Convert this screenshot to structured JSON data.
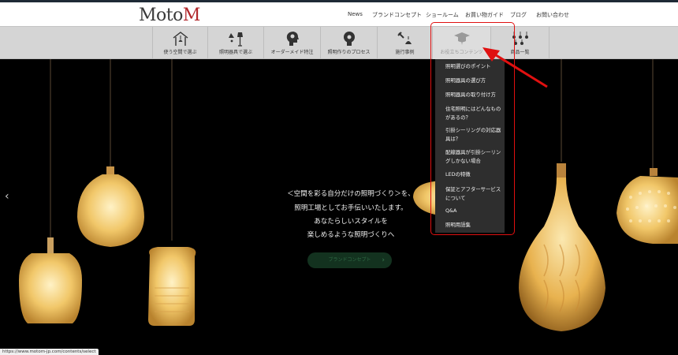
{
  "logo": {
    "text_a": "Moto",
    "text_b": "M"
  },
  "top_nav": [
    {
      "label": "News"
    },
    {
      "label": "ブランドコンセプト"
    },
    {
      "label": "ショールーム"
    },
    {
      "label": "お買い物ガイド"
    },
    {
      "label": "ブログ"
    },
    {
      "label": "お問い合わせ"
    }
  ],
  "categories": [
    {
      "label": "使う空間で選ぶ",
      "icon": "house-lamp-icon"
    },
    {
      "label": "照明器具で選ぶ",
      "icon": "lamp-set-icon"
    },
    {
      "label": "オーダーメイド特注",
      "icon": "head-bulb-icon"
    },
    {
      "label": "照明作りのプロセス",
      "icon": "bulb-gear-icon"
    },
    {
      "label": "施行事例",
      "icon": "hammer-lamp-icon"
    },
    {
      "label": "お役立ちコンテンツ",
      "icon": "graduation-cap-icon"
    },
    {
      "label": "商品一覧",
      "icon": "pendant-grid-icon"
    }
  ],
  "dropdown": {
    "items": [
      {
        "label": "照明選びのポイント"
      },
      {
        "label": "照明器具の選び方"
      },
      {
        "label": "照明器具の取り付け方"
      },
      {
        "label": "住宅照明にはどんなものがあるの？"
      },
      {
        "label": "引掛シーリングの対応器具は？"
      },
      {
        "label": "配線器具が引掛シーリングしかない場合"
      },
      {
        "label": "LEDの特徴"
      },
      {
        "label": "保証とアフターサービスについて"
      },
      {
        "label": "Q&A"
      },
      {
        "label": "照明用語集"
      }
    ]
  },
  "hero": {
    "lines": [
      "＜空間を彩る自分だけの照明づくり＞を、",
      "照明工場としてお手伝いいたします。",
      "あなたらしいスタイルを",
      "楽しめるような照明づくりへ"
    ],
    "cta_label": "ブランドコンセプト",
    "cta_arrow": "›",
    "prev_arrow": "‹"
  },
  "status_bar": {
    "url": "https://www.motom-jp.com/contents/select"
  },
  "colors": {
    "accent_red": "#e01010",
    "brand_red": "#b1272b",
    "dropdown_bg": "#2e2e2e",
    "cta_bg": "#13321f"
  }
}
